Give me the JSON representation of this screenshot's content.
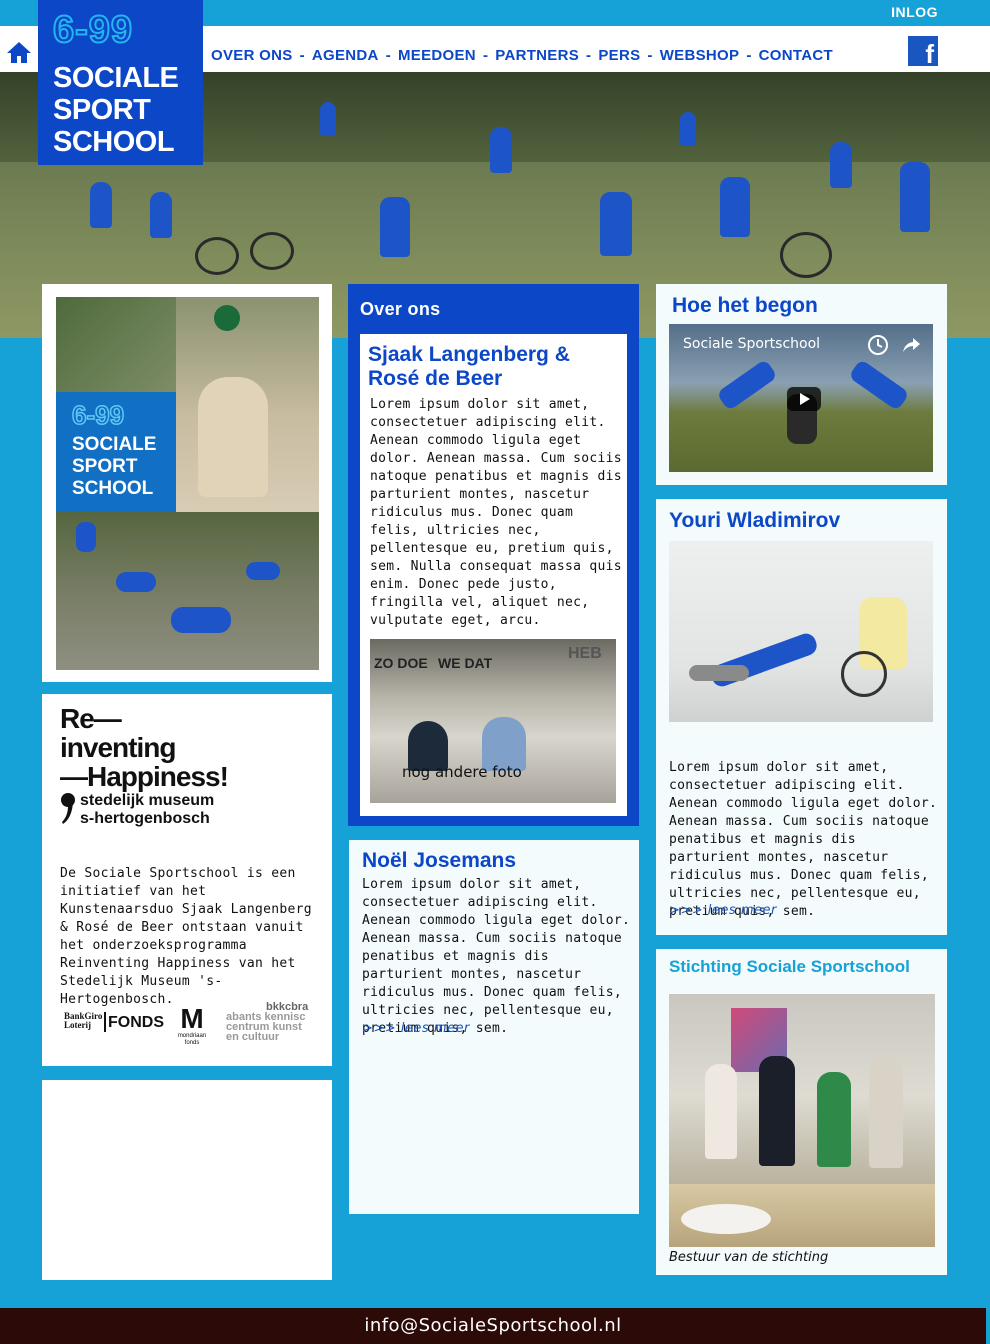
{
  "topbar": {
    "login_label": "INLOG"
  },
  "logo": {
    "number": "6-99",
    "line1": "SOCIALE",
    "line2": "SPORT",
    "line3": "SCHOOL"
  },
  "nav": {
    "items": [
      {
        "label": "OVER ONS"
      },
      {
        "label": "AGENDA"
      },
      {
        "label": "MEEDOEN"
      },
      {
        "label": "PARTNERS"
      },
      {
        "label": "PERS"
      },
      {
        "label": "WEBSHOP"
      },
      {
        "label": "CONTACT"
      }
    ],
    "separator": "-"
  },
  "facebook": {
    "glyph": "f"
  },
  "poster": {
    "number": "6-99",
    "line1": "SOCIALE",
    "line2": "SPORT",
    "line3": "SCHOOL"
  },
  "reinventing": {
    "title1": "Re—",
    "title2": "inventing",
    "title3": "—Happiness!",
    "museum1": "stedelijk museum",
    "museum2": "s-hertogenbosch",
    "text": "De Sociale Sportschool is een initiatief van het Kunstenaarsduo Sjaak Langenberg & Rosé de Beer ontstaan vanuit het onderzoeksprogramma Reinventing Happiness van het Stedelijk Museum 's-Hertogenbosch.",
    "sponsor1a": "BankGiro",
    "sponsor1b": "Loterij",
    "sponsor1c": "FONDS",
    "sponsor2a": "M",
    "sponsor2b": "mondriaan",
    "sponsor2c": "fonds",
    "sponsor3a": "bkkcbra",
    "sponsor3b": "abants kennisc",
    "sponsor3c": "centrum kunst",
    "sponsor3d": "en cultuur"
  },
  "over_ons": {
    "header": "Over ons",
    "title": "Sjaak Langenberg & Rosé de Beer",
    "text": "Lorem ipsum dolor sit amet, consectetuer adipiscing elit. Aenean commodo ligula eget dolor. Aenean massa. Cum sociis natoque penatibus et magnis dis parturient montes, nascetur ridiculus mus. Donec quam felis, ultricies nec, pellentesque eu, pretium quis, sem. Nulla consequat massa quis enim. Donec pede justo, fringilla vel, aliquet nec, vulputate eget, arcu.",
    "photo_caption": "nog andere foto",
    "photo_sign1": "ZO DOE",
    "photo_sign2": "WE DAT",
    "photo_sign3": "HEB"
  },
  "noel": {
    "title": "Noël Josemans",
    "text": "Lorem ipsum dolor sit amet, consectetuer adipiscing elit. Aenean commodo ligula eget dolor. Aenean massa. Cum sociis natoque penatibus et magnis dis parturient montes, nascetur ridiculus mus. Donec quam felis, ultricies nec, pellentesque eu, pretium quis, sem.",
    "more": ">>> lees meer"
  },
  "hoe": {
    "title": "Hoe het begon",
    "video_title": "Sociale Sportschool"
  },
  "youri": {
    "title": "Youri Wladimirov",
    "text": "Lorem ipsum dolor sit amet, consectetuer adipiscing elit. Aenean commodo ligula eget dolor. Aenean massa. Cum sociis natoque penatibus et magnis dis parturient montes, nascetur ridiculus mus. Donec quam felis, ultricies nec, pellentesque eu, pretium quis, sem.",
    "more": ">>> lees meer"
  },
  "stichting": {
    "title": "Stichting Sociale Sportschool",
    "caption": "Bestuur van de stichting"
  },
  "footer": {
    "email": "info@SocialeSportschool.nl"
  },
  "colors": {
    "accent": "#0b47c6",
    "background": "#16a2d6",
    "footer": "#2b0a08"
  }
}
